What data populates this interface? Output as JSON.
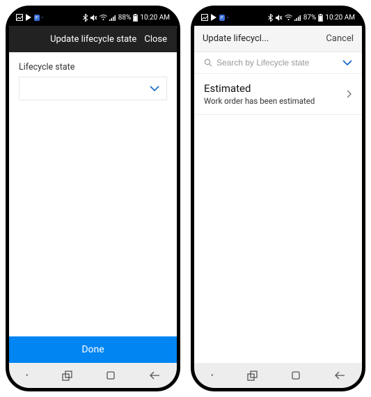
{
  "left": {
    "status": {
      "battery": "88%",
      "time": "10:20 AM"
    },
    "header": {
      "title": "Update lifecycle state",
      "close": "Close"
    },
    "field_label": "Lifecycle state",
    "done": "Done"
  },
  "right": {
    "status": {
      "battery": "87%",
      "time": "10:20 AM"
    },
    "header": {
      "title": "Update lifecycl...",
      "cancel": "Cancel"
    },
    "search_placeholder": "Search by Lifecycle state",
    "item": {
      "title": "Estimated",
      "subtitle": "Work order has been estimated"
    }
  },
  "icons": {
    "gallery": "gallery-icon",
    "play": "google-play-icon",
    "pro": "pro-badge-icon",
    "bt": "bluetooth-icon",
    "mute": "mute-icon",
    "wifi": "wifi-icon",
    "signal": "signal-icon",
    "batt": "battery-icon",
    "search": "search-icon",
    "chevd": "chevron-down-icon",
    "chevr": "chevron-right-icon",
    "recent": "recent-apps-icon",
    "home": "home-icon",
    "back": "back-icon"
  }
}
